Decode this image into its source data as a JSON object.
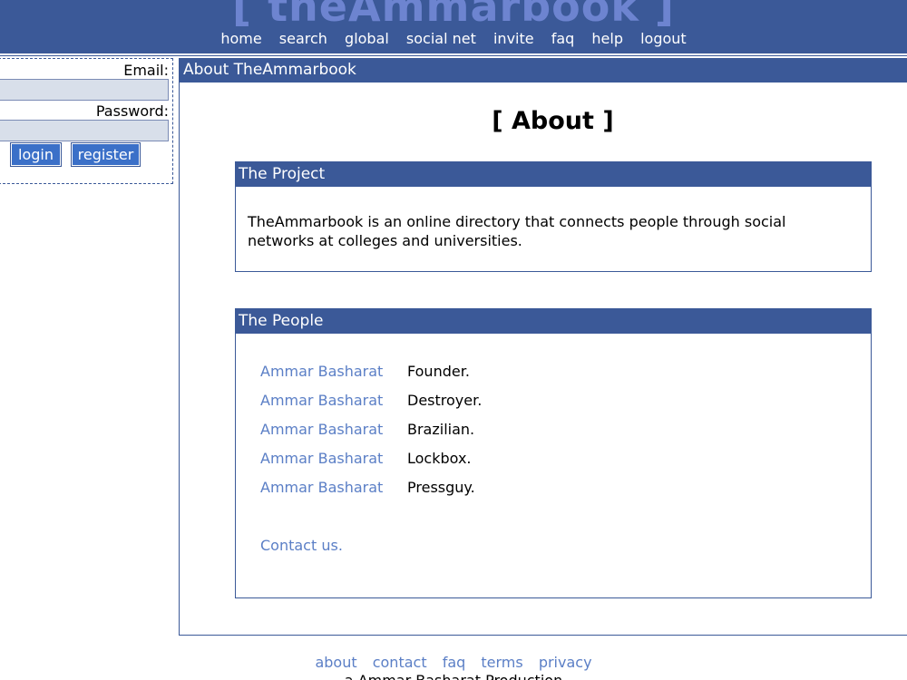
{
  "header": {
    "logo": "[ theAmmarbook ]",
    "nav": [
      "home",
      "search",
      "global",
      "social net",
      "invite",
      "faq",
      "help",
      "logout"
    ]
  },
  "login": {
    "email_label": "Email:",
    "email_value": "",
    "password_label": "Password:",
    "password_value": "",
    "login_button": "login",
    "register_button": "register"
  },
  "main": {
    "title": "About TheAmmarbook",
    "heading": "[ About ]",
    "project": {
      "title": "The Project",
      "text": "TheAmmarbook is an online directory that connects people through social networks at colleges and universities."
    },
    "people": {
      "title": "The People",
      "list": [
        {
          "name": "Ammar Basharat",
          "role": "Founder."
        },
        {
          "name": "Ammar Basharat",
          "role": "Destroyer."
        },
        {
          "name": "Ammar Basharat",
          "role": "Brazilian."
        },
        {
          "name": "Ammar Basharat",
          "role": "Lockbox."
        },
        {
          "name": "Ammar Basharat",
          "role": "Pressguy."
        }
      ],
      "contact": "Contact us."
    }
  },
  "footer": {
    "links": [
      "about",
      "contact",
      "faq",
      "terms",
      "privacy"
    ],
    "credit": "a Ammar Basharat Production"
  },
  "colors": {
    "brand_blue": "#3b5998",
    "link_blue": "#5b7fc6",
    "input_bg": "#d8dfea",
    "button_blue": "#3b70c8"
  }
}
